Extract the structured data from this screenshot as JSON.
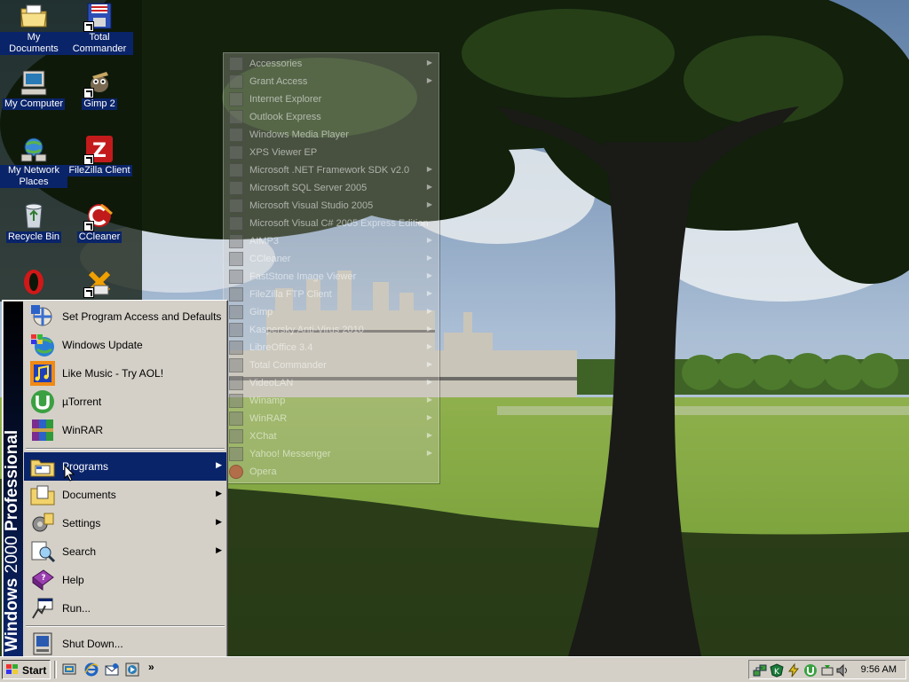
{
  "desktop": {
    "icons": [
      {
        "label": "My Documents",
        "icon": "my-documents-icon"
      },
      {
        "label": "Total Commander",
        "icon": "total-commander-icon"
      },
      {
        "label": "My Computer",
        "icon": "my-computer-icon"
      },
      {
        "label": "Gimp 2",
        "icon": "gimp-icon"
      },
      {
        "label": "My Network Places",
        "icon": "network-places-icon"
      },
      {
        "label": "FileZilla Client",
        "icon": "filezilla-icon"
      },
      {
        "label": "Recycle Bin",
        "icon": "recycle-bin-icon"
      },
      {
        "label": "CCleaner",
        "icon": "ccleaner-icon"
      },
      {
        "label": "",
        "icon": "opera-icon"
      },
      {
        "label": "",
        "icon": "xchat-icon"
      }
    ]
  },
  "programs_menu": {
    "items": [
      {
        "label": "Accessories",
        "has_submenu": true
      },
      {
        "label": "Grant Access",
        "has_submenu": true
      },
      {
        "label": "Internet Explorer",
        "has_submenu": false
      },
      {
        "label": "Outlook Express",
        "has_submenu": false
      },
      {
        "label": "Windows Media Player",
        "has_submenu": false
      },
      {
        "label": "XPS Viewer EP",
        "has_submenu": false
      },
      {
        "label": "Microsoft .NET Framework SDK v2.0",
        "has_submenu": true
      },
      {
        "label": "Microsoft SQL Server 2005",
        "has_submenu": true
      },
      {
        "label": "Microsoft Visual Studio 2005",
        "has_submenu": true
      },
      {
        "label": "Microsoft Visual C# 2005 Express Edition",
        "has_submenu": false
      },
      {
        "label": "AIMP3",
        "has_submenu": true
      },
      {
        "label": "CCleaner",
        "has_submenu": true
      },
      {
        "label": "FastStone Image Viewer",
        "has_submenu": true
      },
      {
        "label": "FileZilla FTP Client",
        "has_submenu": true
      },
      {
        "label": "Gimp",
        "has_submenu": true
      },
      {
        "label": "Kaspersky Anti-Virus 2010",
        "has_submenu": true
      },
      {
        "label": "LibreOffice 3.4",
        "has_submenu": true
      },
      {
        "label": "Total Commander",
        "has_submenu": true
      },
      {
        "label": "VideoLAN",
        "has_submenu": true
      },
      {
        "label": "Winamp",
        "has_submenu": true
      },
      {
        "label": "WinRAR",
        "has_submenu": true
      },
      {
        "label": "XChat",
        "has_submenu": true
      },
      {
        "label": "Yahoo! Messenger",
        "has_submenu": true
      },
      {
        "label": "Opera",
        "has_submenu": false
      }
    ]
  },
  "start_menu": {
    "banner_bold": "Windows",
    "banner_regular": "2000",
    "banner_suffix": "Professional",
    "top_items": [
      {
        "label": "Set Program Access and Defaults",
        "icon": "program-access-icon"
      },
      {
        "label": "Windows Update",
        "icon": "windows-update-icon"
      },
      {
        "label": "Like Music - Try AOL!",
        "icon": "aol-music-icon"
      },
      {
        "label": "µTorrent",
        "icon": "utorrent-icon"
      },
      {
        "label": "WinRAR",
        "icon": "winrar-icon"
      }
    ],
    "main_items": [
      {
        "label": "Programs",
        "icon": "programs-icon",
        "has_submenu": true,
        "highlighted": true
      },
      {
        "label": "Documents",
        "icon": "documents-icon",
        "has_submenu": true
      },
      {
        "label": "Settings",
        "icon": "settings-icon",
        "has_submenu": true
      },
      {
        "label": "Search",
        "icon": "search-icon",
        "has_submenu": true
      },
      {
        "label": "Help",
        "icon": "help-icon",
        "has_submenu": false
      },
      {
        "label": "Run...",
        "icon": "run-icon",
        "has_submenu": false
      }
    ],
    "shutdown": {
      "label": "Shut Down...",
      "icon": "shutdown-icon"
    }
  },
  "taskbar": {
    "start_label": "Start",
    "quick_launch": [
      "show-desktop-icon",
      "internet-explorer-icon",
      "outlook-icon",
      "media-player-icon"
    ],
    "more_label": "»",
    "clock": "9:56 AM"
  },
  "colors": {
    "highlight": "#0a246a",
    "face": "#d4d0c8"
  }
}
